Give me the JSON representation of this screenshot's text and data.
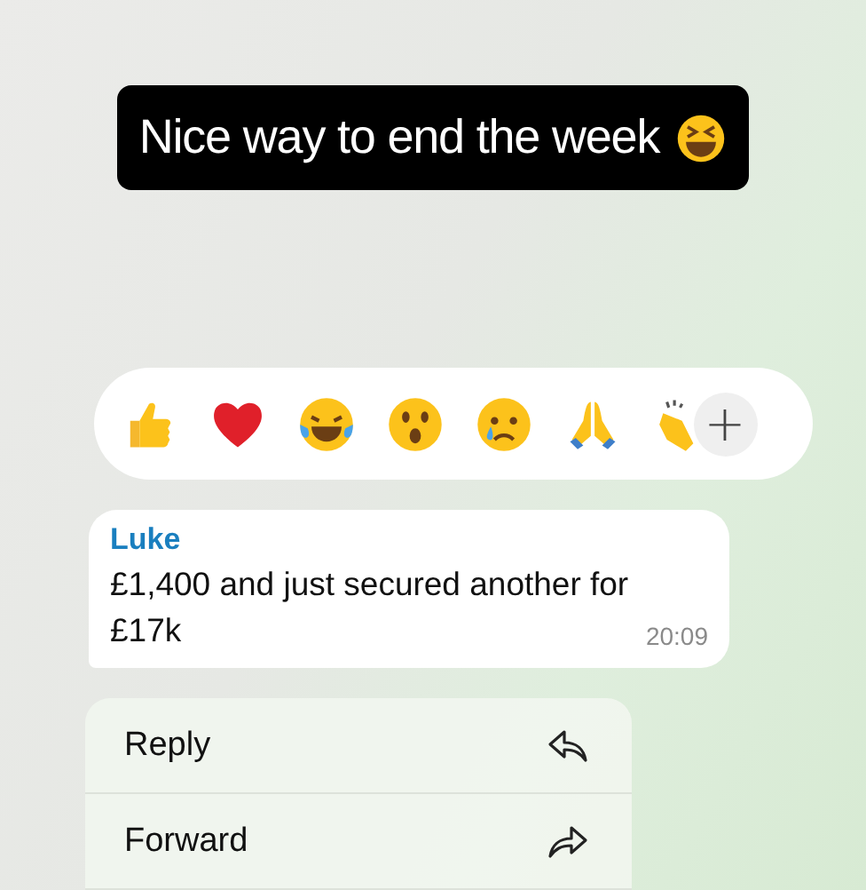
{
  "caption": {
    "text": "Nice way to end the week"
  },
  "reaction_bar": {
    "more_button": "+"
  },
  "message": {
    "sender": "Luke",
    "text": "£1,400 and just secured another for £17k",
    "time": "20:09"
  },
  "menu": [
    {
      "label": "Reply",
      "kind": "reply"
    },
    {
      "label": "Forward",
      "kind": "forward"
    }
  ]
}
